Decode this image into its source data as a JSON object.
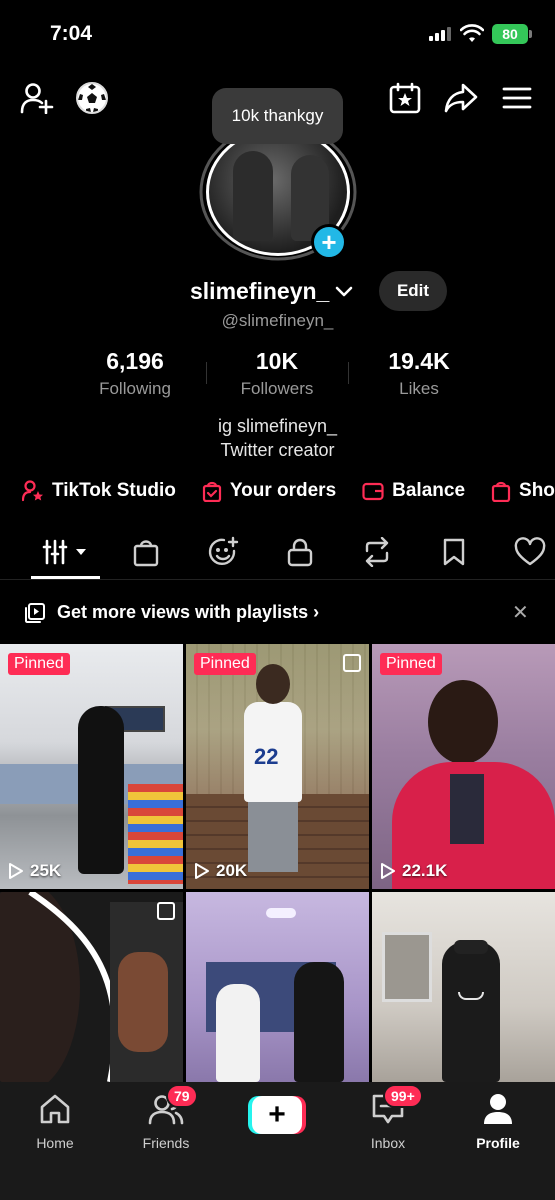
{
  "status_bar": {
    "time": "7:04",
    "battery": "80"
  },
  "header": {
    "add_friend_icon": "person-plus-icon",
    "emoji_icon": "soccer-ball-icon",
    "calendar_icon": "calendar-star-icon",
    "share_icon": "share-arrow-icon",
    "menu_icon": "hamburger-menu-icon"
  },
  "profile": {
    "note": "10k thankgy",
    "username": "slimefineyn_",
    "handle": "@slimefineyn_",
    "edit_label": "Edit",
    "stats": [
      {
        "value": "6,196",
        "label": "Following"
      },
      {
        "value": "10K",
        "label": "Followers"
      },
      {
        "value": "19.4K",
        "label": "Likes"
      }
    ],
    "bio_line1": "ig slimefineyn_",
    "bio_line2": "Twitter creator"
  },
  "quick_links": [
    {
      "label": "TikTok Studio",
      "icon": "person-star-icon"
    },
    {
      "label": "Your orders",
      "icon": "bag-check-icon"
    },
    {
      "label": "Balance",
      "icon": "wallet-icon"
    },
    {
      "label": "Sho",
      "icon": "shop-bag-icon"
    }
  ],
  "tabs": [
    "videos-grid",
    "shop-bag",
    "emoji-sparkle",
    "lock",
    "repost",
    "bookmark",
    "heart"
  ],
  "playlist_banner": {
    "text": "Get more views with playlists ›"
  },
  "videos": [
    {
      "pinned": "Pinned",
      "views": "25K"
    },
    {
      "pinned": "Pinned",
      "views": "20K"
    },
    {
      "pinned": "Pinned",
      "views": "22.1K"
    },
    {
      "pinned": "",
      "views": ""
    },
    {
      "pinned": "",
      "views": ""
    },
    {
      "pinned": "",
      "views": ""
    }
  ],
  "bottom_nav": {
    "home": "Home",
    "friends": "Friends",
    "friends_badge": "79",
    "inbox": "Inbox",
    "inbox_badge": "99+",
    "profile": "Profile"
  },
  "colors": {
    "accent": "#fe2c55",
    "plus": "#22b8e6",
    "battery": "#34c759"
  }
}
